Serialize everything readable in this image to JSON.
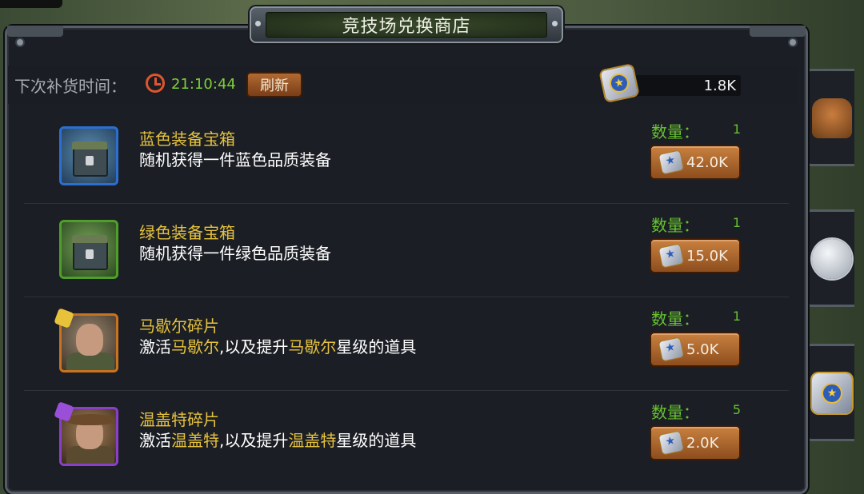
{
  "shop": {
    "title": "竞技场兑换商店",
    "restock_label": "下次补货时间：",
    "restock_timer": "21:10:44",
    "refresh_label": "刷新",
    "currency_amount": "1.8K"
  },
  "labels": {
    "quantity": "数量："
  },
  "items": [
    {
      "name": "蓝色装备宝箱",
      "desc": "随机获得一件蓝色品质装备",
      "quantity": "1",
      "price": "42.0K",
      "frame_color": "#2c6fd0",
      "icon": "blue-equipment-chest-icon"
    },
    {
      "name": "绿色装备宝箱",
      "desc": "随机获得一件绿色品质装备",
      "quantity": "1",
      "price": "15.0K",
      "frame_color": "#4f9e2a",
      "icon": "green-equipment-chest-icon"
    },
    {
      "name": "马歇尔碎片",
      "desc_prefix": "激活",
      "desc_hero1": "马歇尔",
      "desc_mid": ",以及提升",
      "desc_hero2": "马歇尔",
      "desc_suffix": "星级的道具",
      "quantity": "1",
      "price": "5.0K",
      "frame_color": "#c8731f",
      "icon": "marshall-portrait-icon"
    },
    {
      "name": "温盖特碎片",
      "desc_prefix": "激活",
      "desc_hero1": "温盖特",
      "desc_mid": ",以及提升",
      "desc_hero2": "温盖特",
      "desc_suffix": "星级的道具",
      "quantity": "5",
      "price": "2.0K",
      "frame_color": "#8a3fc8",
      "icon": "wingate-portrait-icon"
    }
  ],
  "colors": {
    "name_gold": "#e5c23f",
    "quantity_green": "#67c22f",
    "timer_green": "#7fcf3b",
    "button_brown": "#a8602c"
  }
}
